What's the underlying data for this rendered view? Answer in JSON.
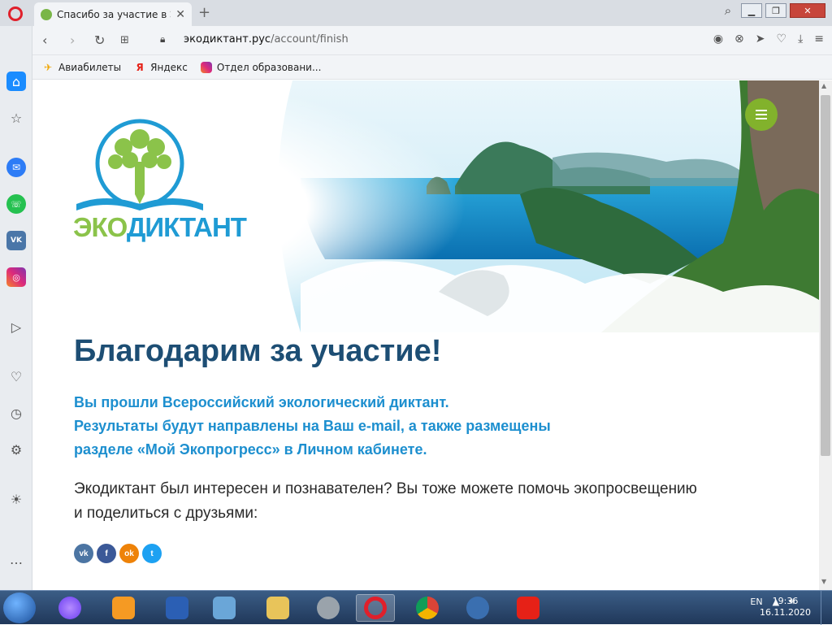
{
  "browser": {
    "tab_title": "Спасибо за участие в Экод",
    "url_host": "экодиктант.рус",
    "url_path": "/account/finish",
    "bookmarks": [
      {
        "label": "Авиабилеты",
        "icon": "plane-icon"
      },
      {
        "label": "Яндекс",
        "icon": "yandex-icon"
      },
      {
        "label": "Отдел образовани...",
        "icon": "instagram-icon"
      }
    ]
  },
  "page": {
    "logo_text_eko": "ЭКО",
    "logo_text_dik": "ДИКТАНТ",
    "heading": "Благодарим за участие!",
    "lead_lines": [
      "Вы прошли Всероссийский экологический диктант.",
      "Результаты будут направлены на Ваш e-mail, а также размещены",
      "разделе «Мой Экопрогресс» в Личном кабинете."
    ],
    "body_lines": [
      "Экодиктант был интересен и познавателен? Вы тоже можете помочь экопросвещению",
      "и поделиться с друзьями:"
    ],
    "share": [
      {
        "label": "vk",
        "network": "vk"
      },
      {
        "label": "f",
        "network": "facebook"
      },
      {
        "label": "ok",
        "network": "odnoklassniki"
      },
      {
        "label": "t",
        "network": "twitter"
      }
    ],
    "colors": {
      "heading": "#1d4e74",
      "lead": "#1d8fcf",
      "menu": "#82b22c"
    }
  },
  "taskbar": {
    "lang": "EN",
    "time": "19:36",
    "date": "16.11.2020"
  }
}
